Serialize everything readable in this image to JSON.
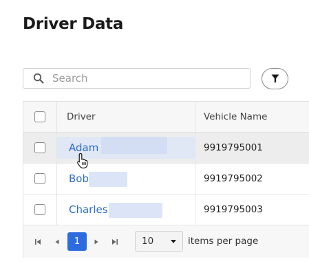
{
  "page": {
    "title": "Driver Data"
  },
  "search": {
    "placeholder": "Search",
    "value": ""
  },
  "filter": {
    "icon": "filter-icon"
  },
  "table": {
    "columns": {
      "driver": "Driver",
      "vehicle": "Vehicle Name"
    },
    "rows": [
      {
        "driver": "Adam",
        "vehicle": "9919795001"
      },
      {
        "driver": "Bob",
        "vehicle": "9919795002"
      },
      {
        "driver": "Charles",
        "vehicle": "9919795003"
      }
    ]
  },
  "pager": {
    "current_page": "1",
    "page_size": "10",
    "items_per_page_label": "items per page"
  },
  "colors": {
    "accent": "#2d6cdf",
    "link": "#2d6cc9",
    "selected_row": "#ededed"
  }
}
